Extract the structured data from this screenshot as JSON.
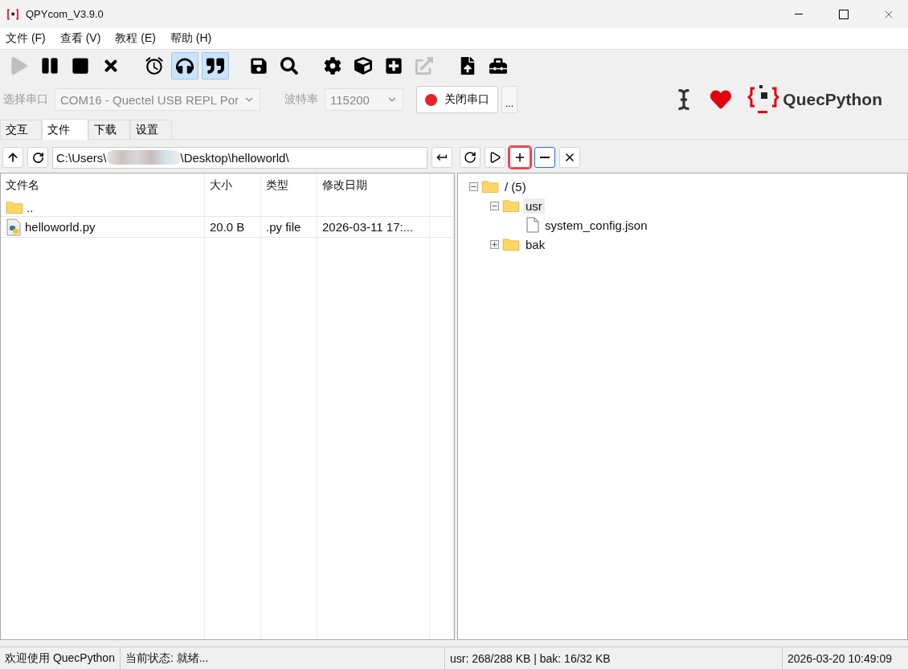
{
  "window": {
    "title": "QPYcom_V3.9.0"
  },
  "menu": [
    "文件 (F)",
    "查看 (V)",
    "教程 (E)",
    "帮助 (H)"
  ],
  "toolbar": [
    {
      "disabled": true,
      "pressed": false
    },
    {
      "disabled": false,
      "pressed": false
    },
    {
      "disabled": false,
      "pressed": false
    },
    {
      "disabled": false,
      "pressed": false
    },
    {
      "disabled": false,
      "pressed": false
    },
    {
      "disabled": false,
      "pressed": true
    },
    {
      "disabled": false,
      "pressed": true
    },
    {
      "disabled": false,
      "pressed": false
    },
    {
      "disabled": false,
      "pressed": false
    },
    {
      "disabled": false,
      "pressed": false
    },
    {
      "disabled": false,
      "pressed": false
    },
    {
      "disabled": false,
      "pressed": false
    },
    {
      "disabled": true,
      "pressed": false
    },
    {
      "disabled": false,
      "pressed": false
    },
    {
      "disabled": false,
      "pressed": false
    }
  ],
  "connection": {
    "port_label": "选择串口",
    "port_value": "COM16 - Quectel USB REPL Por",
    "baud_label": "波特率",
    "baud_value": "115200",
    "open": true,
    "toggle_label": "关闭串口",
    "more": "...",
    "brand": "QuecPython"
  },
  "tabs": [
    {
      "label": "交互",
      "selected": false
    },
    {
      "label": "文件",
      "selected": true
    },
    {
      "label": "下载",
      "selected": false
    },
    {
      "label": "设置",
      "selected": false
    }
  ],
  "local": {
    "path_start": "C:\\Users\\",
    "path_end": "\\Desktop\\helloworld\\",
    "columns": [
      "文件名",
      "大小",
      "类型",
      "修改日期"
    ],
    "rows": [
      {
        "kind": "parent",
        "name": ".."
      },
      {
        "kind": "python",
        "name": "helloworld.py",
        "size": "20.0 B",
        "type": ".py file",
        "modified": "2026-03-11 17:..."
      }
    ]
  },
  "device": {
    "buttons": [
      {
        "highlighted": false,
        "focused": false
      },
      {
        "highlighted": false,
        "focused": false
      },
      {
        "highlighted": true,
        "focused": false
      },
      {
        "highlighted": false,
        "focused": true
      },
      {
        "highlighted": false,
        "focused": false
      }
    ],
    "tree": [
      {
        "kind": "folder",
        "label": "/ (5)",
        "expanded": true,
        "selected": false,
        "children": [
          {
            "kind": "folder",
            "label": "usr",
            "expanded": true,
            "selected": true,
            "children": [
              {
                "kind": "file",
                "label": "system_config.json",
                "selected": false
              }
            ]
          },
          {
            "kind": "folder",
            "label": "bak",
            "expanded": false,
            "selected": false
          }
        ]
      }
    ]
  },
  "status_bar": {
    "welcome": "欢迎使用 QuecPython",
    "state": "当前状态: 就绪...",
    "storage": "usr: 268/288 KB | bak: 16/32 KB",
    "time": "2026-03-20 10:49:09"
  }
}
